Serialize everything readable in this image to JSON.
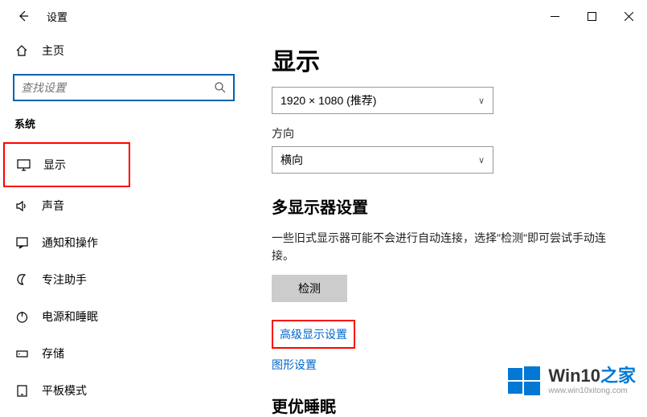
{
  "titlebar": {
    "title": "设置"
  },
  "sidebar": {
    "home_label": "主页",
    "search_placeholder": "查找设置",
    "section_label": "系统",
    "items": [
      {
        "label": "显示",
        "icon": "monitor-icon",
        "highlight": true
      },
      {
        "label": "声音",
        "icon": "sound-icon"
      },
      {
        "label": "通知和操作",
        "icon": "notification-icon"
      },
      {
        "label": "专注助手",
        "icon": "focus-icon"
      },
      {
        "label": "电源和睡眠",
        "icon": "power-icon"
      },
      {
        "label": "存储",
        "icon": "storage-icon"
      },
      {
        "label": "平板模式",
        "icon": "tablet-icon"
      }
    ]
  },
  "main": {
    "heading": "显示",
    "resolution_value": "1920 × 1080 (推荐)",
    "orientation_label": "方向",
    "orientation_value": "横向",
    "multi_heading": "多显示器设置",
    "multi_desc": "一些旧式显示器可能不会进行自动连接，选择\"检测\"即可尝试手动连接。",
    "detect_button": "检测",
    "advanced_link": "高级显示设置",
    "graphics_link": "图形设置",
    "sleep_heading": "更优睡眠"
  },
  "watermark": {
    "brand_prefix": "Win10",
    "brand_suffix": "之家",
    "url": "www.win10xitong.com"
  }
}
